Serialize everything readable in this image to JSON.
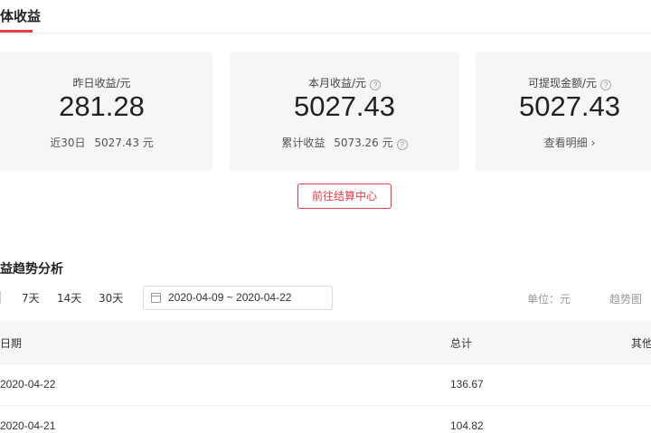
{
  "tab": {
    "active_label": "体收益"
  },
  "cards": [
    {
      "label": "昨日收益/元",
      "value": "281.28",
      "sub_label": "近30日",
      "sub_value": "5027.43 元",
      "has_help": false
    },
    {
      "label": "本月收益/元",
      "value": "5027.43",
      "sub_label": "累计收益",
      "sub_value": "5073.26 元",
      "has_help": true
    },
    {
      "label": "可提现金额/元",
      "value": "5027.43",
      "sub_label": "查看明细",
      "has_help": true
    }
  ],
  "settle_button": {
    "label": "前往结算中心"
  },
  "trend": {
    "title": "益趋势分析",
    "ranges": [
      "7天",
      "14天",
      "30天"
    ],
    "date_range": "2020-04-09 ~ 2020-04-22",
    "unit": "单位：元",
    "chart_link": "趋势图"
  },
  "table": {
    "headers": {
      "date": "日期",
      "total": "总计",
      "other": "其他"
    },
    "rows": [
      {
        "date": "2020-04-22",
        "total": "136.67"
      },
      {
        "date": "2020-04-21",
        "total": "104.82"
      }
    ]
  },
  "icons": {
    "help": "question-circle-icon",
    "arrow": "chevron-right-icon",
    "calendar": "calendar-icon"
  },
  "colors": {
    "accent": "#e2404a",
    "card_bg": "#f6f6f7"
  }
}
